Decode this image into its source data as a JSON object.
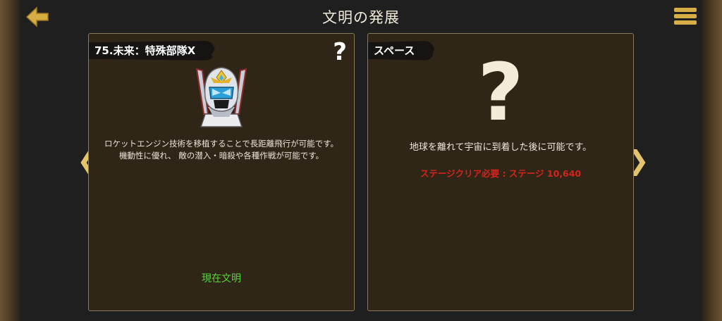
{
  "header": {
    "title": "文明の発展",
    "back_icon": "arrow-left-icon",
    "menu_icon": "hamburger-menu-icon"
  },
  "current_card": {
    "title": "75.未来：特殊部隊X",
    "help_glyph": "?",
    "unit_image": "armored-soldier-helmet-icon",
    "description_lines": [
      "ロケットエンジン技術を移植することで長距離飛行が可能です。",
      "機動性に優れ、 敵の潜入・暗殺や各種作戦が可能です。"
    ],
    "status": "現在文明"
  },
  "next_card": {
    "title": "スペース",
    "locked_glyph": "?",
    "description": "地球を離れて宇宙に到着した後に可能です。",
    "requirement": "ステージクリア必要 : ステージ 10,640"
  },
  "nav": {
    "prev_glyph": "❮",
    "next_glyph": "❯"
  },
  "colors": {
    "accent_gold": "#d7ad45",
    "status_green": "#57d63a",
    "requirement_red": "#d6231c"
  }
}
